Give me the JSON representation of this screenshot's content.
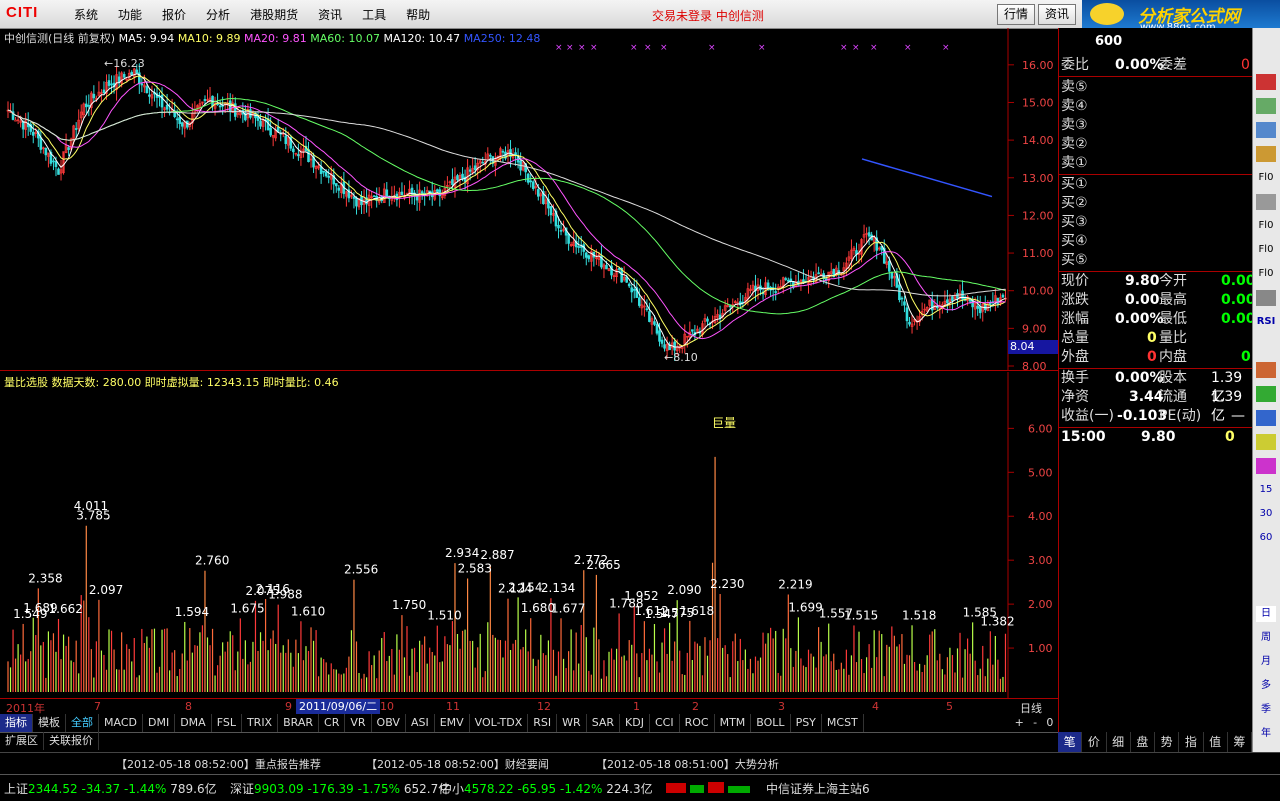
{
  "menubar": {
    "logo": "CITI",
    "items": [
      "系统",
      "功能",
      "报价",
      "分析",
      "港股期货",
      "资讯",
      "工具",
      "帮助"
    ],
    "status": "交易未登录  中创信测",
    "buttons": [
      "行情",
      "资讯"
    ],
    "brand": "分析家公式网",
    "brand_url": "www.88gs.com",
    "colors": {
      "menu_bg": "#e0e0e0",
      "brand": "#ffd200",
      "alert": "#dd0000"
    }
  },
  "price_chart": {
    "legend_name": "中创信测(日线 前复权)",
    "ma": [
      {
        "label": "MA5: 9.94",
        "color": "#ffffff"
      },
      {
        "label": "MA10: 9.89",
        "color": "#ffff66"
      },
      {
        "label": "MA20: 9.81",
        "color": "#ff55ff"
      },
      {
        "label": "MA60: 10.07",
        "color": "#66ff66"
      },
      {
        "label": "MA120: 10.47",
        "color": "#ffffff"
      },
      {
        "label": "MA250: 12.48",
        "color": "#3355ff"
      }
    ],
    "high_label": "16.23",
    "low_label": "8.10",
    "current_tag": "8.04",
    "yticks": [
      "16.00",
      "15.00",
      "14.00",
      "13.00",
      "12.00",
      "11.00",
      "10.00",
      "9.00",
      "8.00"
    ]
  },
  "volume_chart": {
    "header": "量比选股  数据天数: 280.00  即时虚拟量: 12343.15  即时量比: 0.46",
    "peak_label": "巨量",
    "yticks": [
      "6.00",
      "5.00",
      "4.00",
      "3.00",
      "2.00",
      "1.00"
    ],
    "peak_labels": [
      "1.549",
      "1.689",
      "2.358",
      "1.662",
      "4.011",
      "3.785",
      "2.097",
      "1.594",
      "2.760",
      "1.675",
      "2.075",
      "2.116",
      "1.988",
      "1.610",
      "2.556",
      "1.750",
      "1.510",
      "2.934",
      "2.583",
      "2.887",
      "2.124",
      "2.154",
      "1.680",
      "2.134",
      "1.677",
      "2.772",
      "2.665",
      "1.788",
      "1.952",
      "1.612",
      "1.547",
      "1.575",
      "2.090",
      "1.618",
      "2.230",
      "2.219",
      "1.699",
      "1.557",
      "1.515",
      "1.518",
      "1.585",
      "1.382"
    ]
  },
  "chart_data": {
    "type": "bar",
    "title": "量比选股",
    "ylim": [
      0,
      6.5
    ],
    "peak_values": [
      1.549,
      1.689,
      2.358,
      1.662,
      4.011,
      3.785,
      2.097,
      1.594,
      2.76,
      1.675,
      2.075,
      2.116,
      1.988,
      1.61,
      2.556,
      1.75,
      1.51,
      2.934,
      2.583,
      2.887,
      2.124,
      2.154,
      1.68,
      2.134,
      1.677,
      2.772,
      2.665,
      1.788,
      1.952,
      1.612,
      1.547,
      1.575,
      2.09,
      1.618,
      5.35,
      2.23,
      2.219,
      1.699,
      1.557,
      1.515,
      1.518,
      1.585,
      1.382
    ]
  },
  "time_axis": {
    "labels": [
      "2011年",
      "7",
      "8",
      "9",
      "2011/09/06/二",
      "10",
      "11",
      "12",
      "1",
      "2",
      "3",
      "4",
      "5"
    ],
    "period": "日线",
    "controls": [
      "+",
      "-",
      "0"
    ]
  },
  "indicator_tabs": [
    "指标",
    "模板",
    "全部",
    "MACD",
    "DMI",
    "DMA",
    "FSL",
    "TRIX",
    "BRAR",
    "CR",
    "VR",
    "OBV",
    "ASI",
    "EMV",
    "VOL-TDX",
    "RSI",
    "WR",
    "SAR",
    "KDJ",
    "CCI",
    "ROC",
    "MTM",
    "BOLL",
    "PSY",
    "MCST"
  ],
  "bottom_tabs": [
    "扩展区",
    "关联报价"
  ],
  "news": [
    "【2012-05-18 08:52:00】重点报告推荐",
    "【2012-05-18 08:52:00】财经要闻",
    "【2012-05-18 08:51:00】大势分析"
  ],
  "status": {
    "sh": {
      "label": "上证",
      "value": "2344.52",
      "change": "-34.37",
      "pct": "-1.44%",
      "amount": "789.6亿"
    },
    "sz": {
      "label": "深证",
      "value": "9903.09",
      "change": "-176.39",
      "pct": "-1.75%",
      "amount": "652.7亿"
    },
    "zx": {
      "label": "中小",
      "value": "4578.22",
      "change": "-65.95",
      "pct": "-1.42%",
      "amount": "224.3亿"
    },
    "server": "中信证券上海主站6"
  },
  "quote": {
    "code": "600",
    "weibi": {
      "label": "委比",
      "value": "0.00%",
      "label2": "委差",
      "value2": "0"
    },
    "sell": [
      "卖⑤",
      "卖④",
      "卖③",
      "卖②",
      "卖①"
    ],
    "buy": [
      "买①",
      "买②",
      "买③",
      "买④",
      "买⑤"
    ],
    "stats": [
      {
        "l1": "现价",
        "v1": "9.80",
        "l2": "今开",
        "v2": "0.00"
      },
      {
        "l1": "涨跌",
        "v1": "0.00",
        "l2": "最高",
        "v2": "0.00"
      },
      {
        "l1": "涨幅",
        "v1": "0.00%",
        "l2": "最低",
        "v2": "0.00"
      },
      {
        "l1": "总量",
        "v1": "0",
        "l2": "量比",
        "v2": ""
      },
      {
        "l1": "外盘",
        "v1": "0",
        "l2": "内盘",
        "v2": "0"
      }
    ],
    "stats2": [
      {
        "l1": "换手",
        "v1": "0.00%",
        "l2": "股本",
        "v2": "1.39亿"
      },
      {
        "l1": "净资",
        "v1": "3.44",
        "l2": "流通",
        "v2": "1.39亿"
      },
      {
        "l1": "收益(一)",
        "v1": "-0.103",
        "l2": "PE(动)",
        "v2": "—"
      }
    ],
    "tick": {
      "time": "15:00",
      "price": "9.80",
      "vol": "0"
    },
    "bottom_tabs": [
      "笔",
      "价",
      "细",
      "盘",
      "势",
      "指",
      "值",
      "筹"
    ]
  },
  "side_buttons": [
    "Fl0",
    "Fl0",
    "Fl0",
    "Fl0",
    "RSI",
    "日",
    "周",
    "月",
    "多",
    "季",
    "年"
  ]
}
